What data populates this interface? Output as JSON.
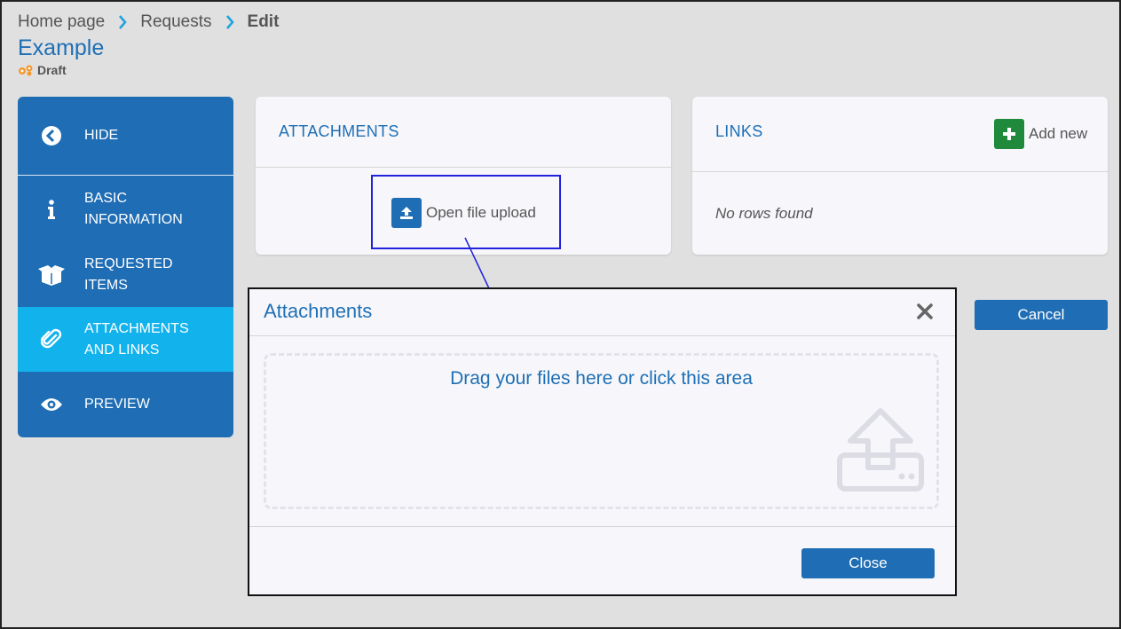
{
  "breadcrumb": {
    "items": [
      "Home page",
      "Requests",
      "Edit"
    ]
  },
  "page": {
    "title": "Example",
    "status": "Draft"
  },
  "sidebar": {
    "items": [
      {
        "label": "HIDE",
        "icon": "chevron-left-circle-icon"
      },
      {
        "label": "BASIC INFORMATION",
        "icon": "info-icon"
      },
      {
        "label": "REQUESTED ITEMS",
        "icon": "box-icon"
      },
      {
        "label": "ATTACHMENTS AND LINKS",
        "icon": "paperclip-icon",
        "active": true
      },
      {
        "label": "PREVIEW",
        "icon": "eye-icon"
      }
    ]
  },
  "attachments_card": {
    "title": "ATTACHMENTS",
    "upload_label": "Open file upload"
  },
  "links_card": {
    "title": "LINKS",
    "add_label": "Add new",
    "empty_text": "No rows found"
  },
  "cancel_label": "Cancel",
  "modal": {
    "title": "Attachments",
    "drop_text": "Drag your files here or click this area",
    "close_label": "Close"
  },
  "colors": {
    "primary": "#1f6db4",
    "active": "#12b3ec",
    "success": "#1f8a3c",
    "status_gear": "#f39a2e"
  }
}
